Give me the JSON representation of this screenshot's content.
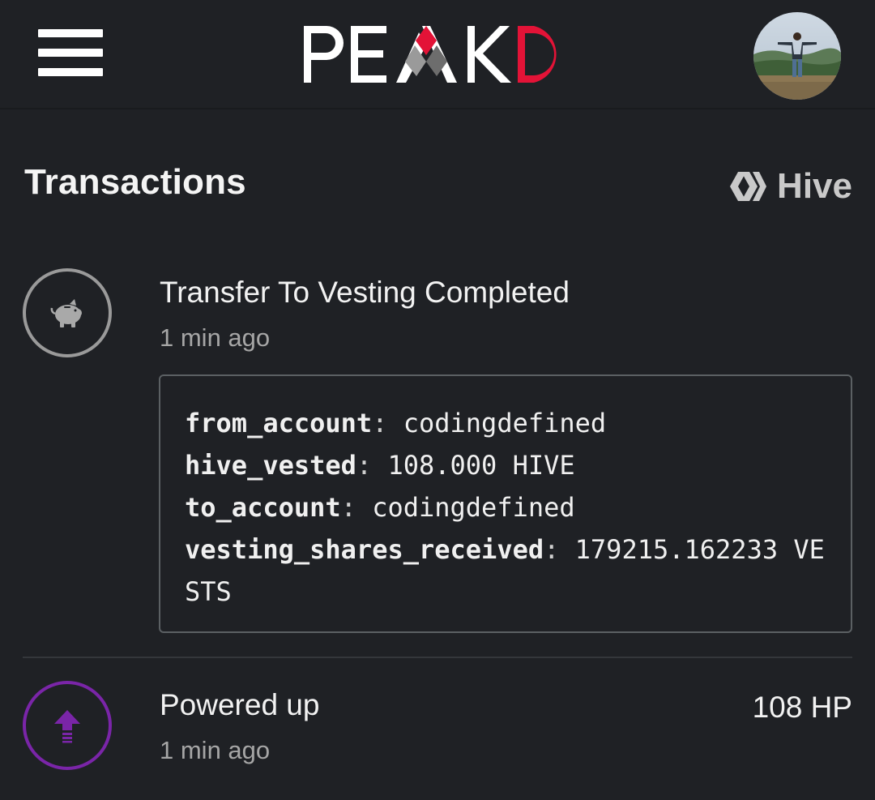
{
  "header": {
    "logo_text": "PEAKD",
    "menu_icon": "hamburger-menu-icon",
    "avatar_icon": "user-avatar"
  },
  "page": {
    "title": "Transactions",
    "chain_label": "Hive",
    "chain_icon": "hive-logo-icon"
  },
  "transactions": [
    {
      "title": "Transfer To Vesting Completed",
      "time": "1 min ago",
      "icon": "piggy-bank-icon",
      "details": [
        {
          "key": "from_account",
          "value": "codingdefined"
        },
        {
          "key": "hive_vested",
          "value": "108.000 HIVE"
        },
        {
          "key": "to_account",
          "value": "codingdefined"
        },
        {
          "key": "vesting_shares_received",
          "value": "179215.162233 VESTS"
        }
      ]
    },
    {
      "title": "Powered up",
      "time": "1 min ago",
      "amount": "108 HP",
      "icon": "power-up-arrow-icon"
    }
  ],
  "colors": {
    "background": "#1f2125",
    "accent_red": "#e31337",
    "power_up_purple": "#7a25a8"
  }
}
